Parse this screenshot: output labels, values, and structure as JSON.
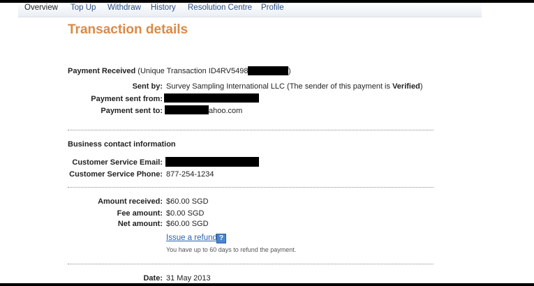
{
  "nav": {
    "items": [
      {
        "label": "Overview"
      },
      {
        "label": "Top Up"
      },
      {
        "label": "Withdraw"
      },
      {
        "label": "History"
      },
      {
        "label": "Resolution Centre"
      },
      {
        "label": "Profile"
      }
    ]
  },
  "page": {
    "title": "Transaction details"
  },
  "payment": {
    "received_label": "Payment Received",
    "transaction_id_text": "(Unique Transaction ID4RV54981V",
    "transaction_id_close": ")",
    "sent_by_label": "Sent by:",
    "sent_by_value": "Survey Sampling International LLC (The sender of this payment is ",
    "verified_text": "Verified",
    "verified_close": ")",
    "sent_from_label": "Payment sent from:",
    "sent_to_label": "Payment sent to:",
    "sent_to_suffix": "ahoo.com"
  },
  "business": {
    "heading": "Business contact information",
    "email_label": "Customer Service Email:",
    "phone_label": "Customer Service Phone:",
    "phone_value": "877-254-1234"
  },
  "amounts": {
    "received_label": "Amount received:",
    "received_value": "$60.00 SGD",
    "fee_label": "Fee amount:",
    "fee_value": "$0.00 SGD",
    "net_label": "Net amount:",
    "net_value": "$60.00 SGD",
    "refund_link": "Issue a refund",
    "help_icon": "question-icon",
    "help_glyph": "?",
    "refund_note": "You have up to 60 days to refund the payment."
  },
  "date": {
    "label": "Date:",
    "value": "31 May 2013"
  },
  "colors": {
    "title": "#d98a47",
    "nav_link": "#2b4f86",
    "link": "#2b5fb0",
    "help_icon_bg": "#4a86cf",
    "redaction": "#000000"
  }
}
